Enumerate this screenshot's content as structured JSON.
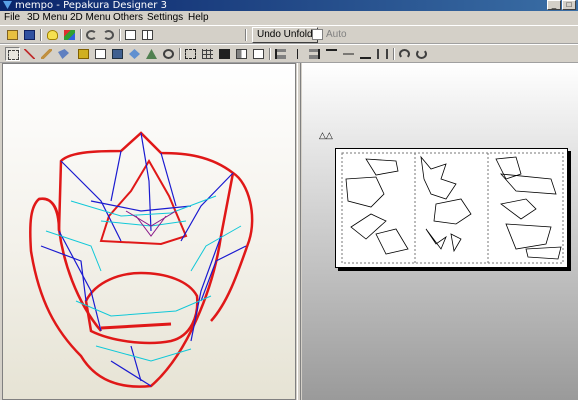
{
  "window": {
    "title": "mempo - Pepakura Designer 3"
  },
  "menu": [
    {
      "label": "File"
    },
    {
      "label": "3D Menu"
    },
    {
      "label": "2D Menu"
    },
    {
      "label": "Others"
    },
    {
      "label": "Settings"
    },
    {
      "label": "Help"
    }
  ],
  "toolbar1": {
    "undo_unfold_label": "Undo Unfold",
    "auto_label": "Auto",
    "auto_checked": false
  },
  "icons": {
    "toolbar1": [
      "open-icon",
      "save-icon",
      "lightbulb-icon",
      "color-cube-icon",
      "rotate-left-icon",
      "rotate-right-icon",
      "view-single-icon",
      "view-split-icon"
    ],
    "toolbar2": [
      "select-icon",
      "edge-icon",
      "pencil-icon",
      "tag-icon",
      "ruler-icon",
      "paper-icon",
      "photo-icon",
      "unfold-icon",
      "flap-icon",
      "scissors-icon",
      "arrow-icon",
      "join-icon",
      "fit-page-icon",
      "grid-icon",
      "page-number-icon",
      "layout-icon",
      "column-icon",
      "align-left-icon",
      "align-center-icon",
      "align-right-icon",
      "distribute-icon",
      "stack-icon",
      "mirror-icon",
      "zoom-icon"
    ]
  },
  "page_marker": "△△"
}
